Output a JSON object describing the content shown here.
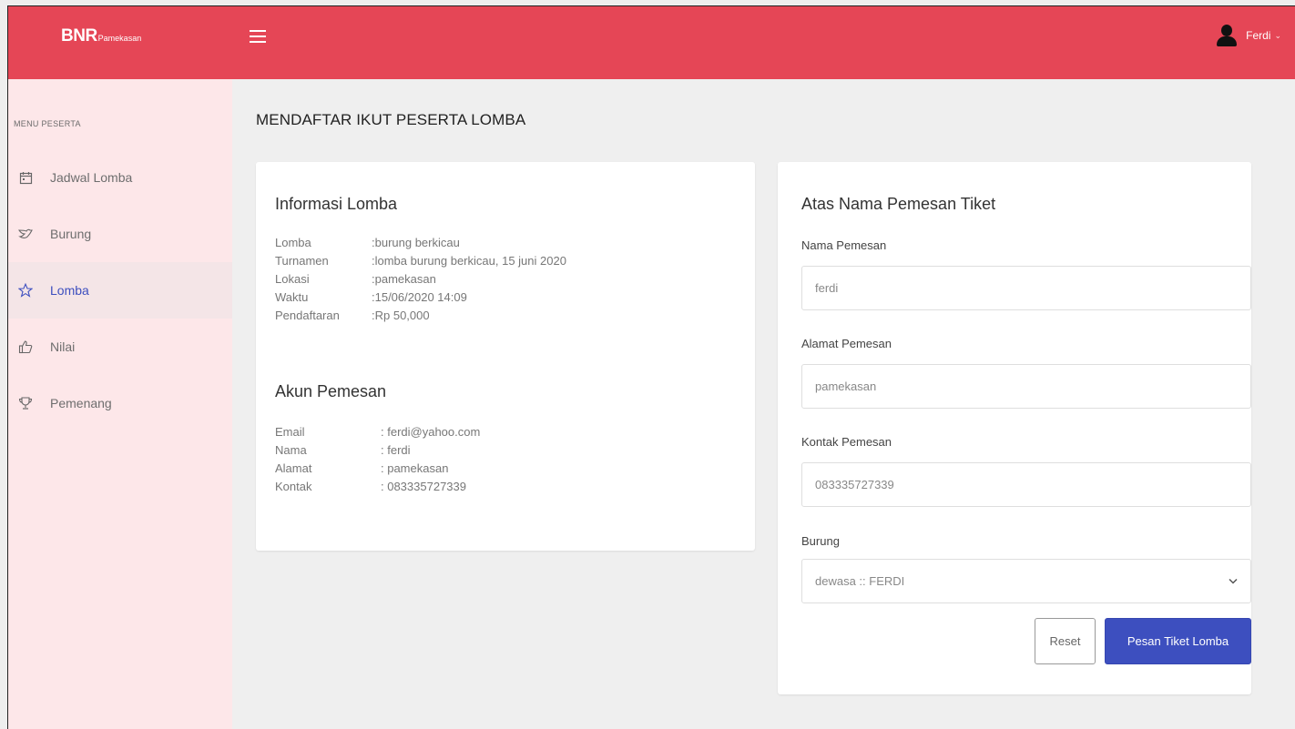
{
  "header": {
    "brand_main": "BNR",
    "brand_sub": "Pamekasan",
    "user_name": "Ferdi",
    "caret": "⌄"
  },
  "sidebar": {
    "heading": "MENU PESERTA",
    "items": [
      {
        "label": "Jadwal Lomba",
        "icon": "calendar-icon"
      },
      {
        "label": "Burung",
        "icon": "bird-icon"
      },
      {
        "label": "Lomba",
        "icon": "star-icon",
        "active": true
      },
      {
        "label": "Nilai",
        "icon": "thumbs-up-icon"
      },
      {
        "label": "Pemenang",
        "icon": "trophy-icon"
      }
    ]
  },
  "page": {
    "title": "MENDAFTAR IKUT PESERTA LOMBA"
  },
  "info": {
    "title": "Informasi Lomba",
    "rows": [
      {
        "key": "Lomba",
        "value": ":burung berkicau"
      },
      {
        "key": "Turnamen",
        "value": ":lomba burung berkicau, 15 juni 2020"
      },
      {
        "key": "Lokasi",
        "value": ":pamekasan"
      },
      {
        "key": "Waktu",
        "value": ":15/06/2020 14:09"
      },
      {
        "key": "Pendaftaran",
        "value": ":Rp 50,000"
      }
    ]
  },
  "account": {
    "title": "Akun Pemesan",
    "rows": [
      {
        "key": "Email",
        "value": ": ferdi@yahoo.com"
      },
      {
        "key": "Nama",
        "value": ": ferdi"
      },
      {
        "key": "Alamat",
        "value": ": pamekasan"
      },
      {
        "key": "Kontak",
        "value": ": 083335727339"
      }
    ]
  },
  "form": {
    "title": "Atas Nama Pemesan Tiket",
    "name_label": "Nama Pemesan",
    "name_value": "ferdi",
    "address_label": "Alamat Pemesan",
    "address_value": "pamekasan",
    "contact_label": "Kontak Pemesan",
    "contact_value": "083335727339",
    "bird_label": "Burung",
    "bird_selected": "dewasa :: FERDI",
    "reset_label": "Reset",
    "submit_label": "Pesan Tiket Lomba"
  },
  "colors": {
    "accent": "#e54656",
    "sidebar_bg": "#fde7e9",
    "primary_button": "#3d4fbf"
  }
}
